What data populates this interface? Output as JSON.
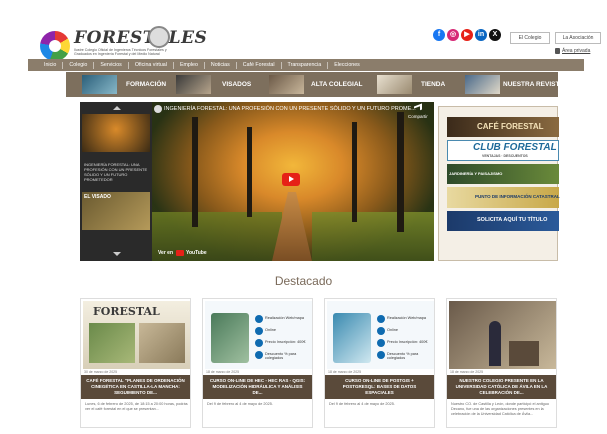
{
  "header": {
    "logo_word": "FORESTALES",
    "logo_sub": "Ilustre Colegio Oficial de Ingenieros Técnicos Forestales y Graduados en Ingeniería Forestal y del Medio Natural",
    "btn_colegio": "El Colegio",
    "btn_bolsa": "La Asociación",
    "access": "Área privada"
  },
  "nav": {
    "items": [
      "Inicio",
      "Colegio",
      "Servicios",
      "Oficina virtual",
      "Empleo",
      "Noticias",
      "Café Forestal",
      "Transparencia",
      "Elecciones"
    ]
  },
  "subnav": {
    "items": [
      "FORMACIÓN",
      "VISADOS",
      "ALTA COLEGIAL",
      "TIENDA",
      "NUESTRA REVISTA"
    ]
  },
  "video": {
    "title": "INGENIERÍA FORESTAL: UNA PROFESIÓN CON UN PRESENTE SÓLIDO Y UN FUTURO PROME...",
    "share": "Compartir",
    "ver_en": "Ver en",
    "yt": "YouTube",
    "playlist": [
      {
        "text": "INGENIERÍA FORESTAL: UNA PROFESIÓN CON UN PRESENTE SÓLIDO Y UN FUTURO PROMETEDOR"
      },
      {
        "text": "EL VISADO"
      }
    ]
  },
  "promo": {
    "cafe": "CAFÉ FORESTAL",
    "club": "CLUB FORESTAL",
    "club_sub": "VENTAJAS · DESCUENTOS",
    "jardineria": "JARDINERÍA Y PAISAJISMO",
    "punto": "PUNTO DE INFORMACIÓN CATASTRAL",
    "solicita": "SOLICITA AQUÍ TU TÍTULO"
  },
  "destacado": "Destacado",
  "cards": [
    {
      "date": "30 de marzo de 2025",
      "title": "CAFÉ FORESTAL \"PLANES DE ORDENACIÓN CINEGÉTICA EN CASTILLA-LA MANCHA: SEGUIMIENTO DE...",
      "excerpt": "Lunes, 6 de febrero de 2025, de 18:15 a 20:00 horas, podrás ver el café forestal en el que se presentan..."
    },
    {
      "date": "18 de marzo de 2025",
      "title": "CURSO ON-LINE DE HEC - HEC RAS - QGIS: MODELIZACIÓN HIDRÁULICA Y ANÁLISIS DE...",
      "excerpt": "Del 9 de febrero al 4 de mayo de 2025."
    },
    {
      "date": "18 de marzo de 2025",
      "title": "CURSO ON-LINE DE POSTGIS + POSTGRESQL: BASES DE DATOS ESPACIALES",
      "excerpt": "Del 9 de febrero al 4 de mayo de 2025."
    },
    {
      "date": "18 de marzo de 2025",
      "title": "NUESTRO COLEGIO PRESENTE EN LA UNIVERSIDAD CATÓLICA DE ÁVILA EN LA CELEBRACIÓN DE...",
      "excerpt": "Nuestro CO. de Castilla y León, donde participó el antiguo Decano, fue una de las organizaciones presentes en la celebración de la Universidad Católica de Ávila..."
    }
  ],
  "card_lists": {
    "c2": [
      "Realización Web/mapa",
      "Online",
      "Precio Inscripción: 400€",
      "Descuento % para colegiados"
    ],
    "c3": [
      "Realización Web/mapa",
      "Online",
      "Precio Inscripción: 400€",
      "Descuento % para colegiados"
    ]
  },
  "colors": {
    "nav": "#8b7d6b",
    "subnav": "#7d6f5d",
    "card_title_bg": "#5a4a3a",
    "accent": "#0f6bb0"
  }
}
